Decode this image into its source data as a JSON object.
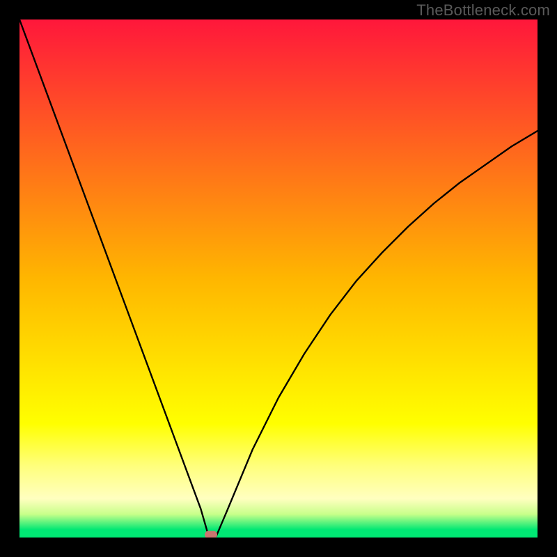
{
  "watermark": "TheBottleneck.com",
  "chart_data": {
    "type": "line",
    "title": "",
    "xlabel": "",
    "ylabel": "",
    "xlim": [
      0,
      100
    ],
    "ylim": [
      0,
      100
    ],
    "series": [
      {
        "name": "bottleneck-curve",
        "x": [
          0,
          5,
          10,
          15,
          20,
          25,
          30,
          35,
          36.5,
          38,
          40,
          45,
          50,
          55,
          60,
          65,
          70,
          75,
          80,
          85,
          90,
          95,
          100
        ],
        "values": [
          100,
          86.5,
          73,
          59.5,
          46,
          32.5,
          19,
          5.5,
          0.3,
          0.3,
          5,
          17,
          27,
          35.5,
          43,
          49.5,
          55,
          60,
          64.5,
          68.5,
          72,
          75.5,
          78.5
        ]
      }
    ],
    "optimum_marker": {
      "x": 37,
      "y": 0.6
    },
    "background": {
      "type": "vertical-gradient",
      "stops": [
        {
          "pos": 0.0,
          "color": "#ff173b"
        },
        {
          "pos": 0.5,
          "color": "#ffb600"
        },
        {
          "pos": 0.78,
          "color": "#ffff00"
        },
        {
          "pos": 0.86,
          "color": "#ffff7a"
        },
        {
          "pos": 0.925,
          "color": "#ffffc0"
        },
        {
          "pos": 0.955,
          "color": "#c8ff8a"
        },
        {
          "pos": 0.985,
          "color": "#00e874"
        },
        {
          "pos": 1.0,
          "color": "#00e874"
        }
      ]
    }
  }
}
